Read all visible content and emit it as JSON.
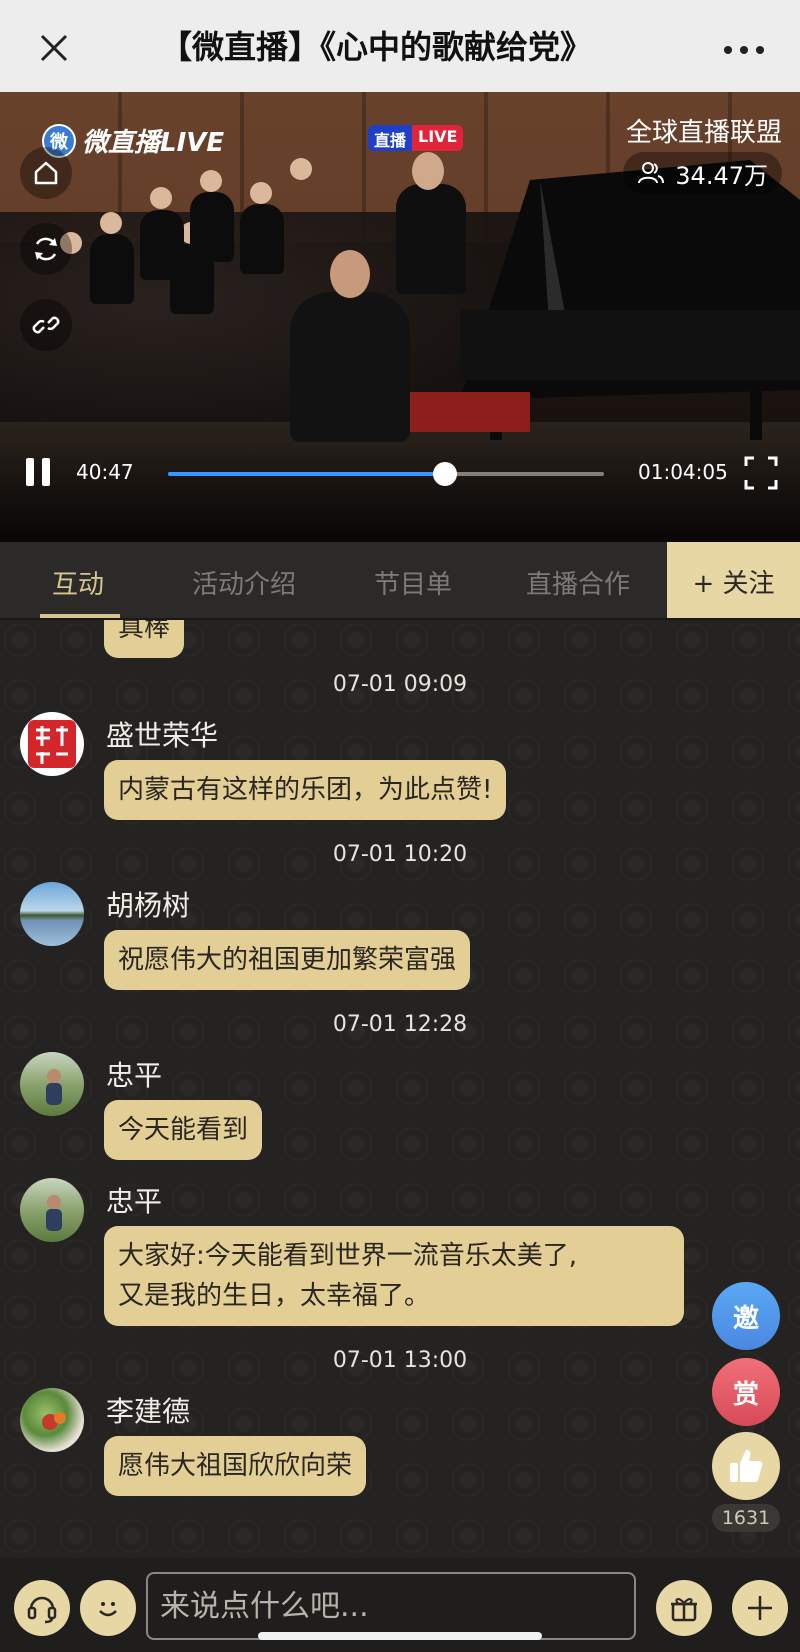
{
  "header": {
    "title": "【微直播】《心中的歌献给党》"
  },
  "video": {
    "brand": "微直播LIVE",
    "brand_logo_char": "微",
    "live_label_cn": "直播",
    "live_label_en": "LIVE",
    "alliance": "全球直播联盟",
    "viewers": "34.47万",
    "time_current": "40:47",
    "time_total": "01:04:05",
    "progress": 0.636
  },
  "tabs": {
    "items": [
      "互动",
      "活动介绍",
      "节目单",
      "直播合作"
    ],
    "active": 0,
    "follow": "+ 关注"
  },
  "chat": {
    "partial_bubble": "真棒",
    "messages": [
      {
        "time": "07-01 09:09",
        "name": "盛世荣华",
        "text": "内蒙古有这样的乐团，为此点赞!"
      },
      {
        "time": "07-01 10:20",
        "name": "胡杨树",
        "text": "祝愿伟大的祖国更加繁荣富强"
      },
      {
        "time": "07-01 12:28",
        "name": "忠平",
        "text": "今天能看到"
      },
      {
        "time": "",
        "name": "忠平",
        "text_line1": "大家好:今天能看到世界一流音乐太美了,",
        "text_line2": "又是我的生日，太幸福了。"
      },
      {
        "time": "07-01 13:00",
        "name": "李建德",
        "text": "愿伟大祖国欣欣向荣"
      }
    ]
  },
  "float_actions": {
    "invite": "邀",
    "reward": "赏",
    "likes": "1631"
  },
  "input": {
    "placeholder": "来说点什么吧..."
  },
  "colors": {
    "accent": "#e3cf96",
    "tab_active": "#d9c48f",
    "progress": "#3b95ff"
  }
}
